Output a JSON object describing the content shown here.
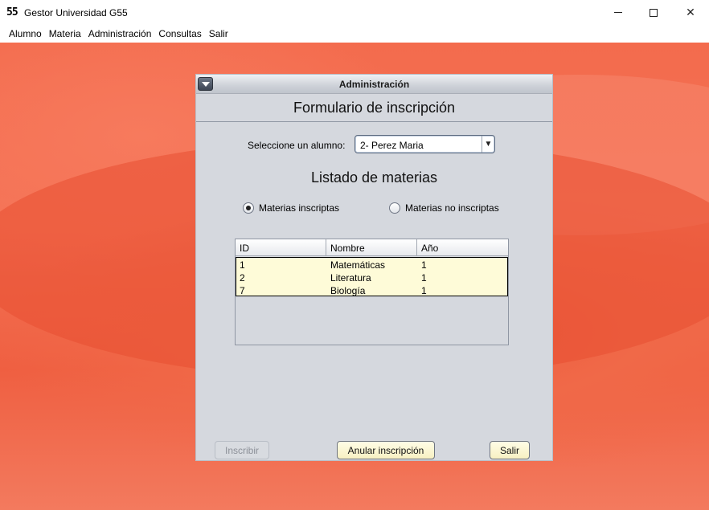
{
  "window": {
    "icon_text": "55",
    "title": "Gestor Universidad G55"
  },
  "menubar": {
    "items": [
      "Alumno",
      "Materia",
      "Administración",
      "Consultas",
      "Salir"
    ]
  },
  "internal_frame": {
    "title": "Administración",
    "form_title": "Formulario de inscripción",
    "alumno_label": "Seleccione un alumno:",
    "alumno_selected": "2- Perez Maria",
    "list_title": "Listado de materias",
    "radio_inscriptas": {
      "label": "Materias inscriptas",
      "checked": true
    },
    "radio_no_inscriptas": {
      "label": "Materias no inscriptas",
      "checked": false
    },
    "table": {
      "columns": [
        "ID",
        "Nombre",
        "Año"
      ],
      "rows": [
        [
          "1",
          "Matemáticas",
          "1"
        ],
        [
          "2",
          "Literatura",
          "1"
        ],
        [
          "7",
          "Biología",
          "1"
        ]
      ]
    },
    "buttons": {
      "inscribir": "Inscribir",
      "anular": "Anular inscripción",
      "salir": "Salir"
    }
  },
  "colors": {
    "desktop": "#f06948",
    "frame_bg": "#d5d8de",
    "row_highlight": "#fefbd8"
  }
}
